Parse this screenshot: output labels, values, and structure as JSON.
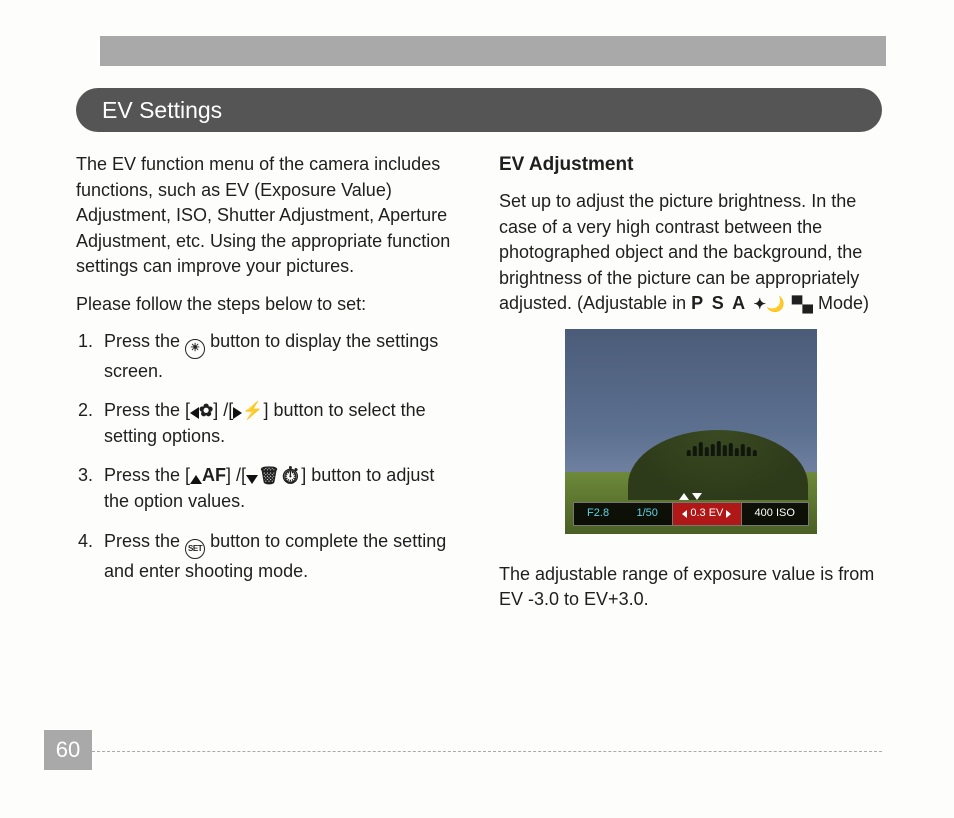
{
  "header": {
    "title": "EV Settings"
  },
  "left": {
    "intro": "The EV function menu of the camera includes functions, such as EV (Exposure Value) Adjustment, ISO, Shutter Adjustment, Aperture Adjustment, etc. Using the appropriate function settings can improve your pictures.",
    "lead": "Please follow the steps below to set:",
    "steps": {
      "s1a": "Press the ",
      "s1b": " button to display the settings screen.",
      "s2a": "Press the [",
      "s2b": "] /[",
      "s2c": "] button to select the setting options.",
      "s3a": "Press the [",
      "s3af": "AF",
      "s3b": "] /[",
      "s3c": "] button to adjust the option values.",
      "s4a": "Press the ",
      "s4set": "SET",
      "s4b": " button to complete the setting and enter shooting mode."
    }
  },
  "right": {
    "heading": "EV Adjustment",
    "body_a": "Set up to adjust the picture brightness. In the case of a very high contrast between the photographed object and the background, the brightness of the picture can be appropriately adjusted. (Adjustable in ",
    "modes": "P S A",
    "body_b": " Mode)",
    "range": "The adjustable range of exposure value is from EV -3.0 to EV+3.0."
  },
  "preview": {
    "f": "F2.8",
    "shutter": "1/50",
    "ev": "0.3 EV",
    "iso": "400 ISO"
  },
  "page": "60"
}
